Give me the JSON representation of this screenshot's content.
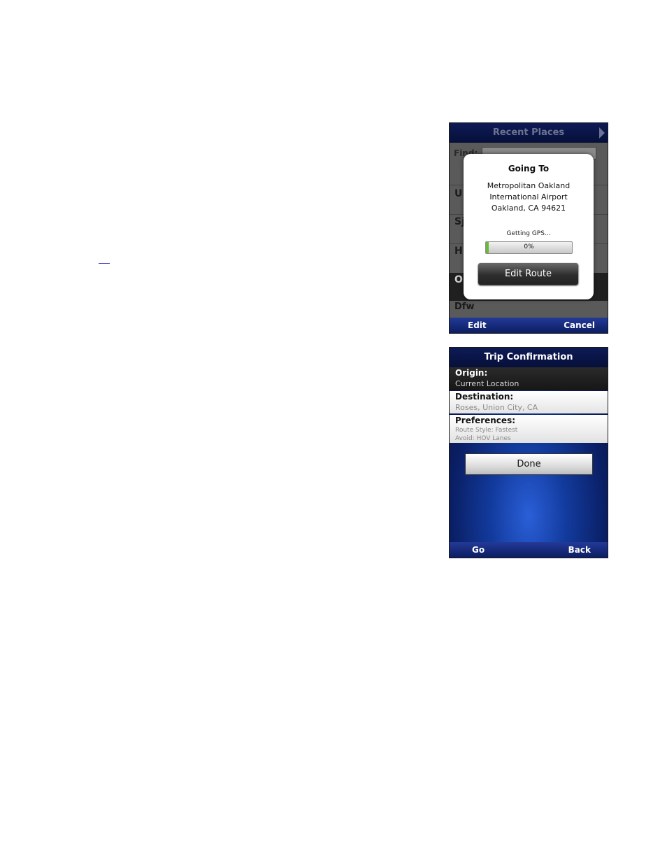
{
  "screen1": {
    "title": "Recent Places",
    "find_label": "Find:",
    "row_letters": [
      "U",
      "Sj",
      "H",
      "O"
    ],
    "last_row": "Dfw",
    "dialog": {
      "title": "Going To",
      "address_line1": "Metropolitan Oakland",
      "address_line2": "International Airport",
      "address_line3": "Oakland, CA 94621",
      "status": "Getting GPS...",
      "progress_percent": 3,
      "progress_label": "0%",
      "button": "Edit Route"
    },
    "softkeys": {
      "left": "Edit",
      "right": "Cancel"
    }
  },
  "screen2": {
    "title": "Trip Confirmation",
    "origin": {
      "label": "Origin:",
      "value": "Current Location"
    },
    "destination": {
      "label": "Destination:",
      "value": "Roses, Union City, CA"
    },
    "preferences": {
      "label": "Preferences:",
      "route_style": "Route Style: Fastest",
      "avoid": "Avoid: HOV Lanes"
    },
    "done_button": "Done",
    "softkeys": {
      "left": "Go",
      "right": "Back"
    }
  },
  "colors": {
    "accent_blue": "#233a97",
    "progress_green": "#6bb83b"
  }
}
